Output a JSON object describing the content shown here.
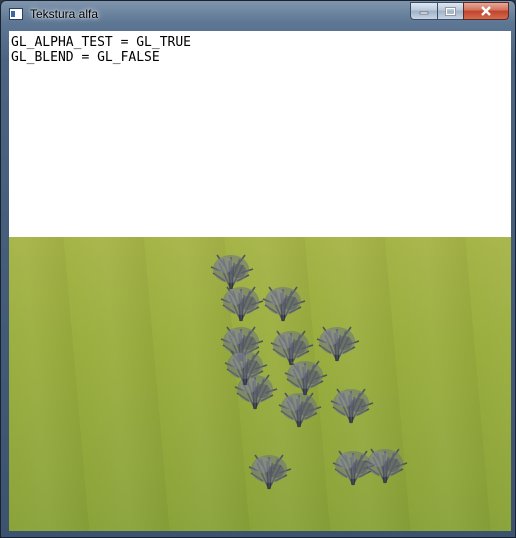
{
  "window": {
    "title": "Tekstura alfa",
    "icon": "app-window-icon",
    "controls": [
      "minimize-icon",
      "maximize-icon",
      "close-icon"
    ]
  },
  "overlay": {
    "line1": "GL_ALPHA_TEST = GL_TRUE",
    "line2": "GL_BLEND = GL_FALSE"
  },
  "scene": {
    "sky_color": "#ffffff",
    "ground_color": "#9aae3e",
    "foliage_color": "#5a5f6b"
  }
}
